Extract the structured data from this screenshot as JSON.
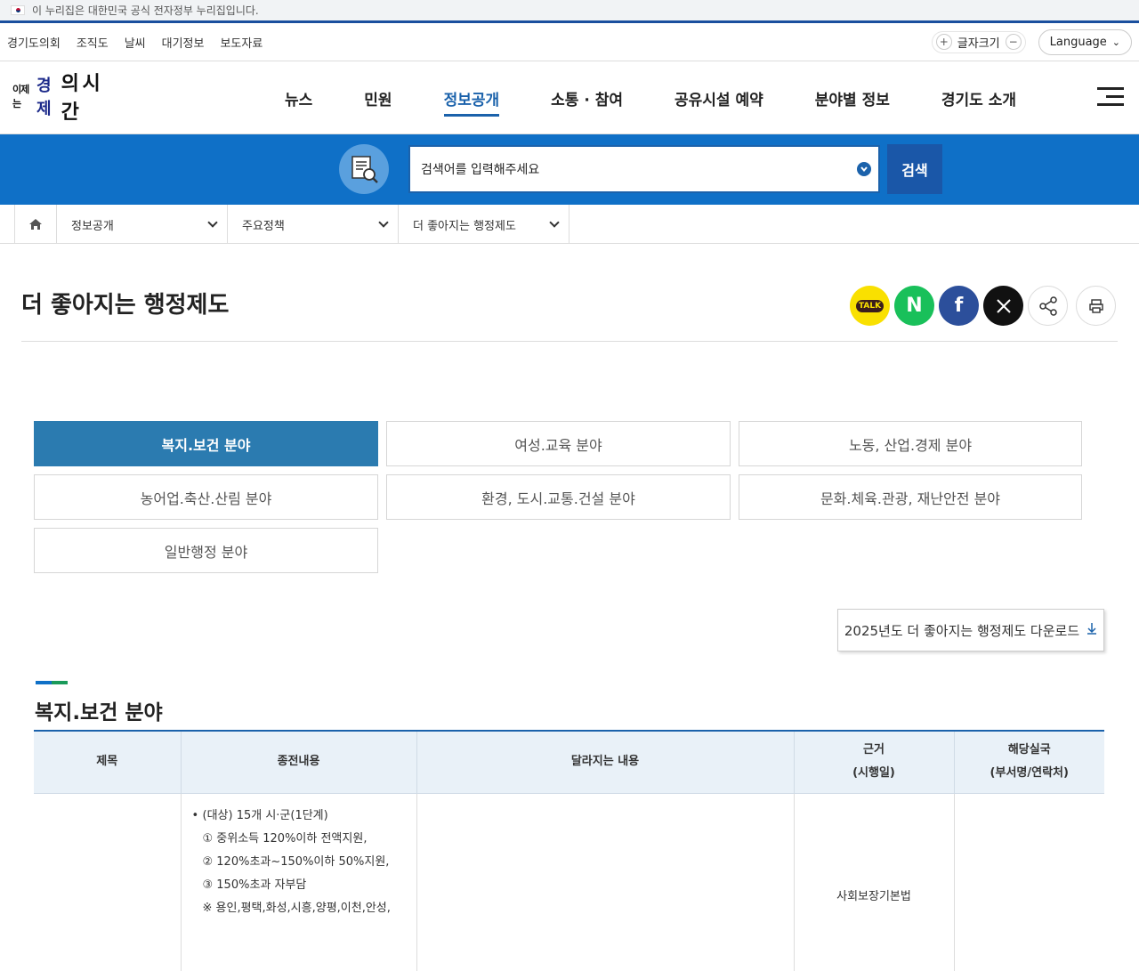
{
  "gov_banner": {
    "text": "이 누리집은 대한민국 공식 전자정부 누리집입니다."
  },
  "util": {
    "links": [
      "경기도의회",
      "조직도",
      "날씨",
      "대기정보",
      "보도자료"
    ],
    "font_size_label": "글자크기",
    "language_label": "Language"
  },
  "logo": {
    "part1": "이제는",
    "part2": "경제",
    "part3": "의 시간"
  },
  "gnb": [
    "뉴스",
    "민원",
    "정보공개",
    "소통 · 참여",
    "공유시설 예약",
    "분야별 정보",
    "경기도 소개"
  ],
  "gnb_active": "정보공개",
  "search": {
    "placeholder": "검색어를 입력해주세요",
    "button": "검색"
  },
  "breadcrumb": [
    "정보공개",
    "주요정책",
    "더 좋아지는 행정제도"
  ],
  "page_title": "더 좋아지는 행정제도",
  "share": {
    "kakao": "TALK",
    "naver": "N",
    "facebook": "f"
  },
  "tabs": [
    "복지.보건 분야",
    "여성.교육 분야",
    "노동, 산업.경제 분야",
    "농어업.축산.산림 분야",
    "환경, 도시.교통.건설 분야",
    "문화.체육.관광, 재난안전 분야",
    "일반행정 분야"
  ],
  "active_tab": "복지.보건 분야",
  "download_label": "2025년도 더 좋아지는 행정제도 다운로드",
  "section_title": "복지.보건 분야",
  "table": {
    "headers": [
      "제목",
      "종전내용",
      "달라지는 내용",
      "근거\n(시행일)",
      "해당실국\n(부서명/연락처)"
    ],
    "header_basis_1": "근거",
    "header_basis_2": "(시행일)",
    "header_dept_1": "해당실국",
    "header_dept_2": "(부서명/연락처)",
    "row1": {
      "prev": [
        "(대상) 15개 시·군(1단계)",
        "① 중위소득 120%이하 전액지원,",
        "② 120%초과~150%이하 50%지원,",
        "③ 150%초과 자부담",
        "※ 용인,평택,화성,시흥,양평,이천,안성,"
      ],
      "basis": "사회보장기본법"
    }
  }
}
